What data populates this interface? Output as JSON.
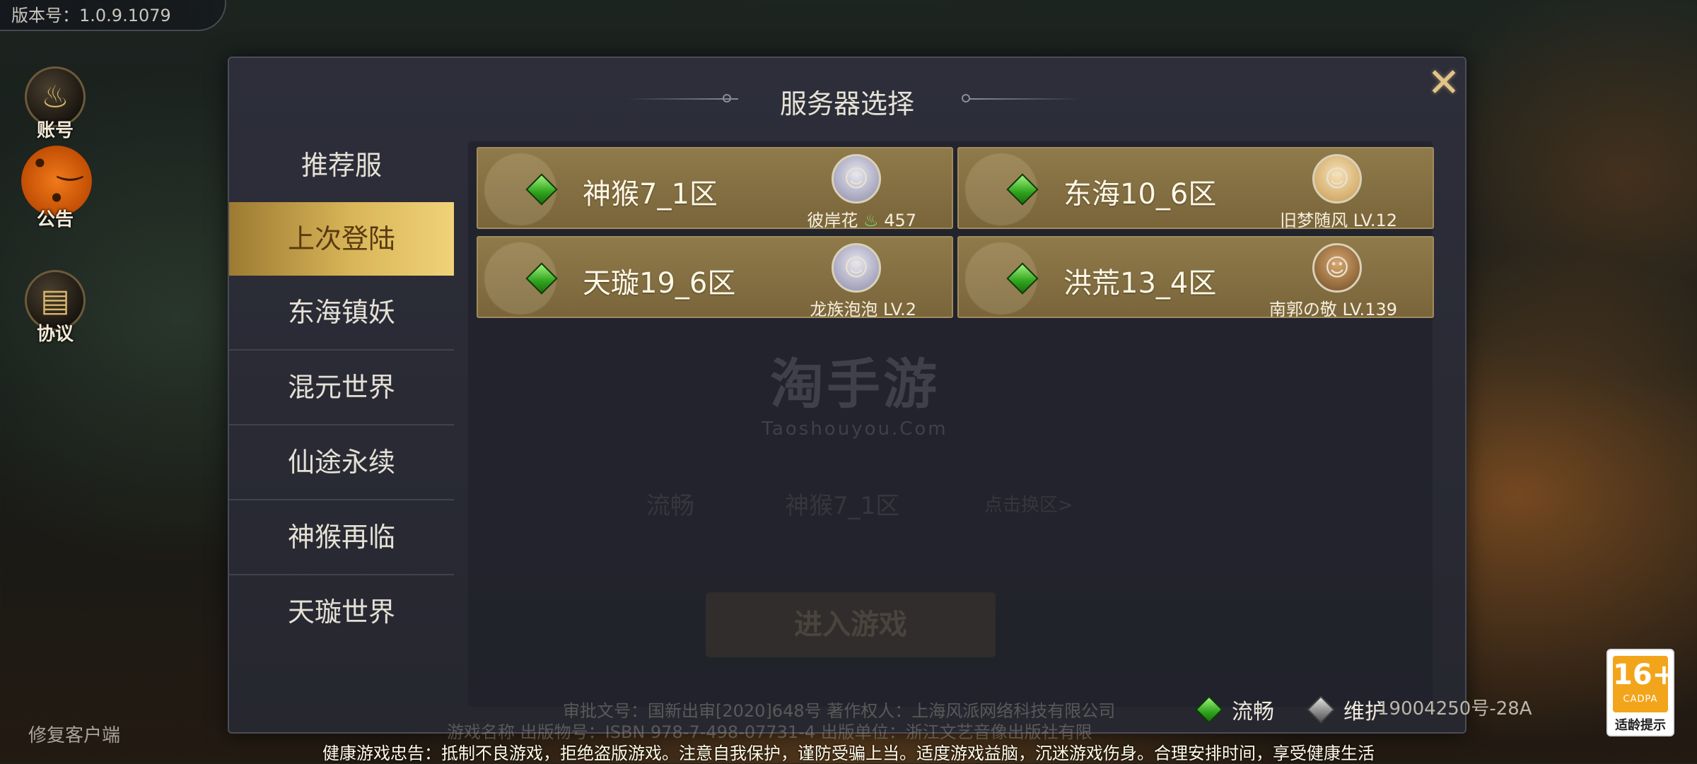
{
  "version": "版本号：1.0.9.1079",
  "side_icons": [
    {
      "label": "账号",
      "icon": "gourd-icon"
    },
    {
      "label": "公告",
      "icon": "pumpkin-mascot-icon"
    },
    {
      "label": "协议",
      "icon": "scroll-icon"
    }
  ],
  "repair_client": "修复客户端",
  "modal": {
    "title": "服务器选择",
    "close_icon": "close-icon",
    "tabs": [
      "推荐服",
      "上次登陆",
      "东海镇妖",
      "混元世界",
      "仙途永续",
      "神猴再临",
      "天璇世界"
    ],
    "active_tab": "上次登陆",
    "servers": [
      {
        "name": "神猴7_1区",
        "role_name": "彼岸花",
        "power_icon": "flame-icon",
        "role_level": "457",
        "status": "流畅",
        "avatar": "white-hair-avatar"
      },
      {
        "name": "东海10_6区",
        "role_name": "旧梦随风",
        "role_level": "LV.12",
        "status": "流畅",
        "avatar": "blonde-girl-avatar"
      },
      {
        "name": "天璇19_6区",
        "role_name": "龙族泡泡",
        "role_level": "LV.2",
        "status": "流畅",
        "avatar": "white-hair-avatar"
      },
      {
        "name": "洪荒13_4区",
        "role_name": "南郭の敬",
        "role_level": "LV.139",
        "status": "流畅",
        "avatar": "monkey-avatar"
      }
    ],
    "legend": {
      "smooth": "流畅",
      "maintenance": "维护"
    }
  },
  "watermark": {
    "big": "淘手游",
    "small": "Taoshouyou.Com"
  },
  "background_login": {
    "status": "流畅",
    "server": "神猴7_1区",
    "change": "点击换区>",
    "enter": "进入游戏"
  },
  "license_text": {
    "line1": "审批文号：国新出审[2020]648号  著作权人：上海风派网络科技有限公司",
    "line2": "游戏名称  出版物号：ISBN 978-7-498-07731-4  出版单位：浙江文艺音像出版社有限",
    "tail": "19004250号-28A"
  },
  "health_notice": "健康游戏忠告：抵制不良游戏，拒绝盗版游戏。注意自我保护，谨防受骗上当。适度游戏益脑，沉迷游戏伤身。合理安排时间，享受健康生活",
  "age_rating": {
    "number": "16+",
    "org": "CADPA",
    "text": "适龄提示"
  }
}
